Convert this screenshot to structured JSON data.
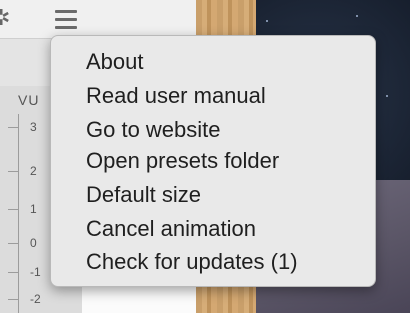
{
  "panel": {
    "vu_label": "VU",
    "scale": [
      "3",
      "2",
      "1",
      "0",
      "-1",
      "-2"
    ]
  },
  "menu": {
    "items": [
      "About",
      "Read user manual",
      "Go to website",
      "Open presets folder",
      "Default size",
      "Cancel animation",
      "Check for updates (1)"
    ]
  },
  "icons": {
    "settings": "gear-icon",
    "menu": "hamburger-menu-icon"
  }
}
